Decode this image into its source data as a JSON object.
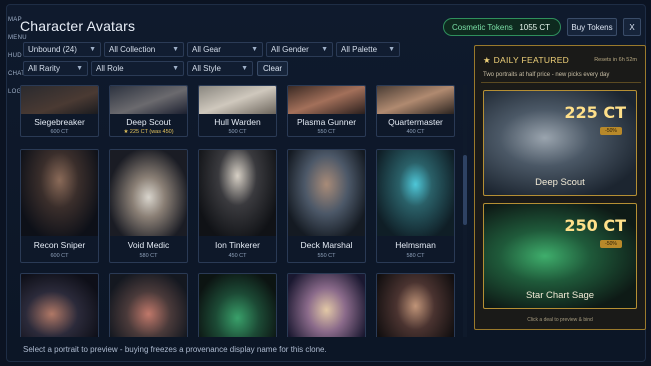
{
  "app": {
    "title": "Character Avatars"
  },
  "nav": {
    "items": [
      "MAP",
      "MENU",
      "HUD",
      "CHAT",
      "LOG"
    ]
  },
  "header": {
    "tokens_label": "Cosmetic Tokens",
    "tokens_value": "1055 CT",
    "buy_label": "Buy Tokens",
    "close_label": "X"
  },
  "filters": {
    "row1": [
      "Unbound (24)",
      "All Collection",
      "All Gear",
      "All Gender",
      "All Palette"
    ],
    "row2": [
      "All Rarity",
      "All Role",
      "All Style"
    ],
    "clear_label": "Clear"
  },
  "grid": {
    "row0": [
      {
        "name": "Siegebreaker",
        "price": "600 CT"
      },
      {
        "name": "Deep Scout",
        "price": "★ 225 CT (was 450)",
        "sale": true
      },
      {
        "name": "Hull Warden",
        "price": "500 CT"
      },
      {
        "name": "Plasma Gunner",
        "price": "550 CT"
      },
      {
        "name": "Quartermaster",
        "price": "400 CT"
      }
    ],
    "row1": [
      {
        "name": "Recon Sniper",
        "price": "600 CT"
      },
      {
        "name": "Void Medic",
        "price": "580 CT"
      },
      {
        "name": "Ion Tinkerer",
        "price": "450 CT"
      },
      {
        "name": "Deck Marshal",
        "price": "550 CT"
      },
      {
        "name": "Helmsman",
        "price": "580 CT"
      }
    ]
  },
  "footer": {
    "note": "Select a portrait to preview - buying freezes a provenance display name for this clone."
  },
  "featured": {
    "header": "DAILY FEATURED",
    "reset": "Resets in 6h 52m",
    "subtitle": "Two portraits at half price - new picks every day",
    "cards": [
      {
        "name": "Deep Scout",
        "price": "225 CT",
        "badge": "-50%"
      },
      {
        "name": "Star Chart Sage",
        "price": "250 CT",
        "badge": "-50%"
      }
    ],
    "note": "Click a deal to preview & bind"
  },
  "colors": {
    "accent_gold": "#f0d27a",
    "token_green": "#2f8f5c",
    "panel_bg": "#0f1a2d"
  }
}
